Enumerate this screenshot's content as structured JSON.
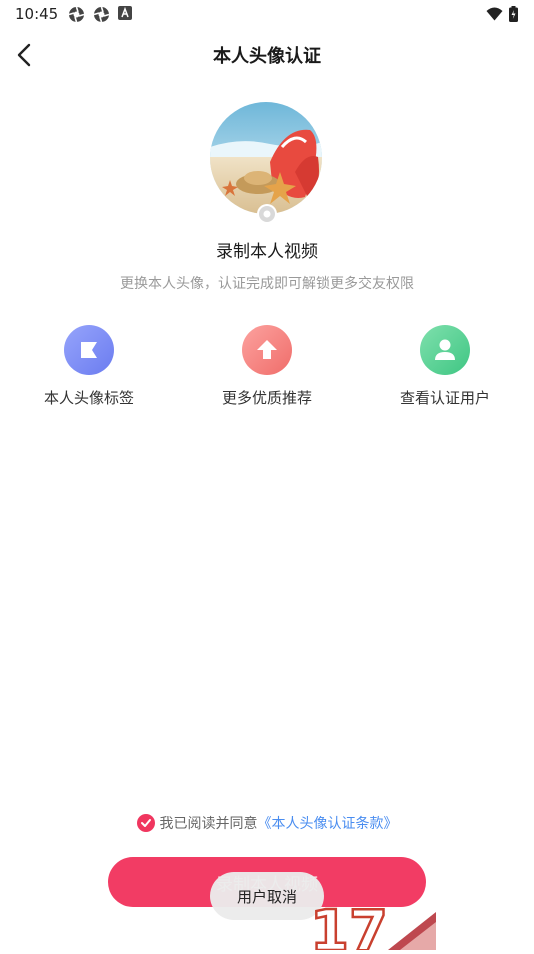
{
  "status_bar": {
    "time": "10:45"
  },
  "header": {
    "title": "本人头像认证"
  },
  "main": {
    "record_title": "录制本人视频",
    "subtitle": "更换本人头像，认证完成即可解锁更多交友权限",
    "features": [
      {
        "label": "本人头像标签",
        "icon": "tag-icon",
        "color": "#7b8cf5"
      },
      {
        "label": "更多优质推荐",
        "icon": "arrow-up-icon",
        "color": "#f47d7b"
      },
      {
        "label": "查看认证用户",
        "icon": "user-icon",
        "color": "#4dd28f"
      }
    ]
  },
  "agreement": {
    "text": "我已阅读并同意",
    "link": "《本人头像认证条款》"
  },
  "record_button": {
    "label": "录制本人视频"
  },
  "toast": {
    "text": "用户取消"
  },
  "watermark": {
    "text": "17"
  },
  "colors": {
    "accent": "#f23c64",
    "link": "#4a8df0"
  }
}
